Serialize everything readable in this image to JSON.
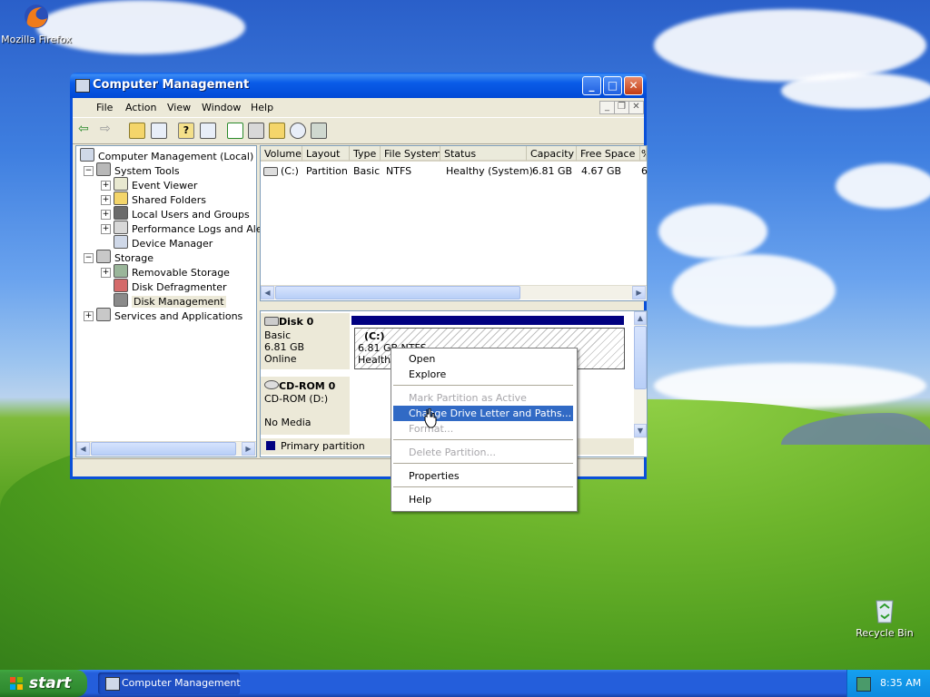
{
  "desktop": {
    "icons": [
      {
        "label": "Mozilla Firefox",
        "icon": "firefox-icon"
      },
      {
        "label": "Recycle Bin",
        "icon": "recycle-bin-icon"
      }
    ]
  },
  "window": {
    "title": "Computer Management",
    "menu": [
      "File",
      "Action",
      "View",
      "Window",
      "Help"
    ],
    "toolbar_icons": [
      "back-arrow-icon",
      "forward-arrow-icon",
      "up-folder-icon",
      "show-hide-tree-icon",
      "help-icon",
      "action-pane-icon",
      "refresh-icon",
      "properties-icon",
      "open-folder-icon",
      "search-icon",
      "disk-settings-icon"
    ],
    "tree": [
      {
        "label": "Computer Management (Local)",
        "icon": "computer-icon"
      },
      {
        "label": "System Tools",
        "icon": "toolbox-icon"
      },
      {
        "label": "Event Viewer",
        "icon": "event-viewer-icon"
      },
      {
        "label": "Shared Folders",
        "icon": "shared-folder-icon"
      },
      {
        "label": "Local Users and Groups",
        "icon": "users-icon"
      },
      {
        "label": "Performance Logs and Alerts",
        "icon": "performance-icon"
      },
      {
        "label": "Device Manager",
        "icon": "device-manager-icon"
      },
      {
        "label": "Storage",
        "icon": "storage-icon"
      },
      {
        "label": "Removable Storage",
        "icon": "removable-storage-icon"
      },
      {
        "label": "Disk Defragmenter",
        "icon": "defrag-icon"
      },
      {
        "label": "Disk Management",
        "icon": "disk-management-icon"
      },
      {
        "label": "Services and Applications",
        "icon": "services-icon"
      }
    ],
    "volume_table": {
      "columns": [
        "Volume",
        "Layout",
        "Type",
        "File System",
        "Status",
        "Capacity",
        "Free Space",
        "%"
      ],
      "rows": [
        [
          "(C:)",
          "Partition",
          "Basic",
          "NTFS",
          "Healthy (System)",
          "6.81 GB",
          "4.67 GB",
          "6"
        ]
      ]
    },
    "disks": [
      {
        "name": "Disk 0",
        "type": "Basic",
        "size": "6.81 GB",
        "status": "Online",
        "partition": {
          "label": "(C:)",
          "detail": "6.81 GB NTFS",
          "status": "Healthy"
        }
      },
      {
        "name": "CD-ROM 0",
        "type": "CD-ROM (D:)",
        "status": "No Media"
      }
    ],
    "legend": "Primary partition",
    "colors": {
      "primary_partition": "#000080",
      "title_bar": "#0a5ce8",
      "highlight": "#316ac5"
    }
  },
  "context_menu": {
    "items": [
      {
        "label": "Open",
        "enabled": true
      },
      {
        "label": "Explore",
        "enabled": true
      },
      {
        "label": "Mark Partition as Active",
        "enabled": false
      },
      {
        "label": "Change Drive Letter and Paths...",
        "enabled": true,
        "highlighted": true
      },
      {
        "label": "Format...",
        "enabled": false
      },
      {
        "label": "Delete Partition...",
        "enabled": false
      },
      {
        "label": "Properties",
        "enabled": true
      },
      {
        "label": "Help",
        "enabled": true
      }
    ]
  },
  "taskbar": {
    "start": "start",
    "task": "Computer Management",
    "clock": "8:35 AM"
  }
}
